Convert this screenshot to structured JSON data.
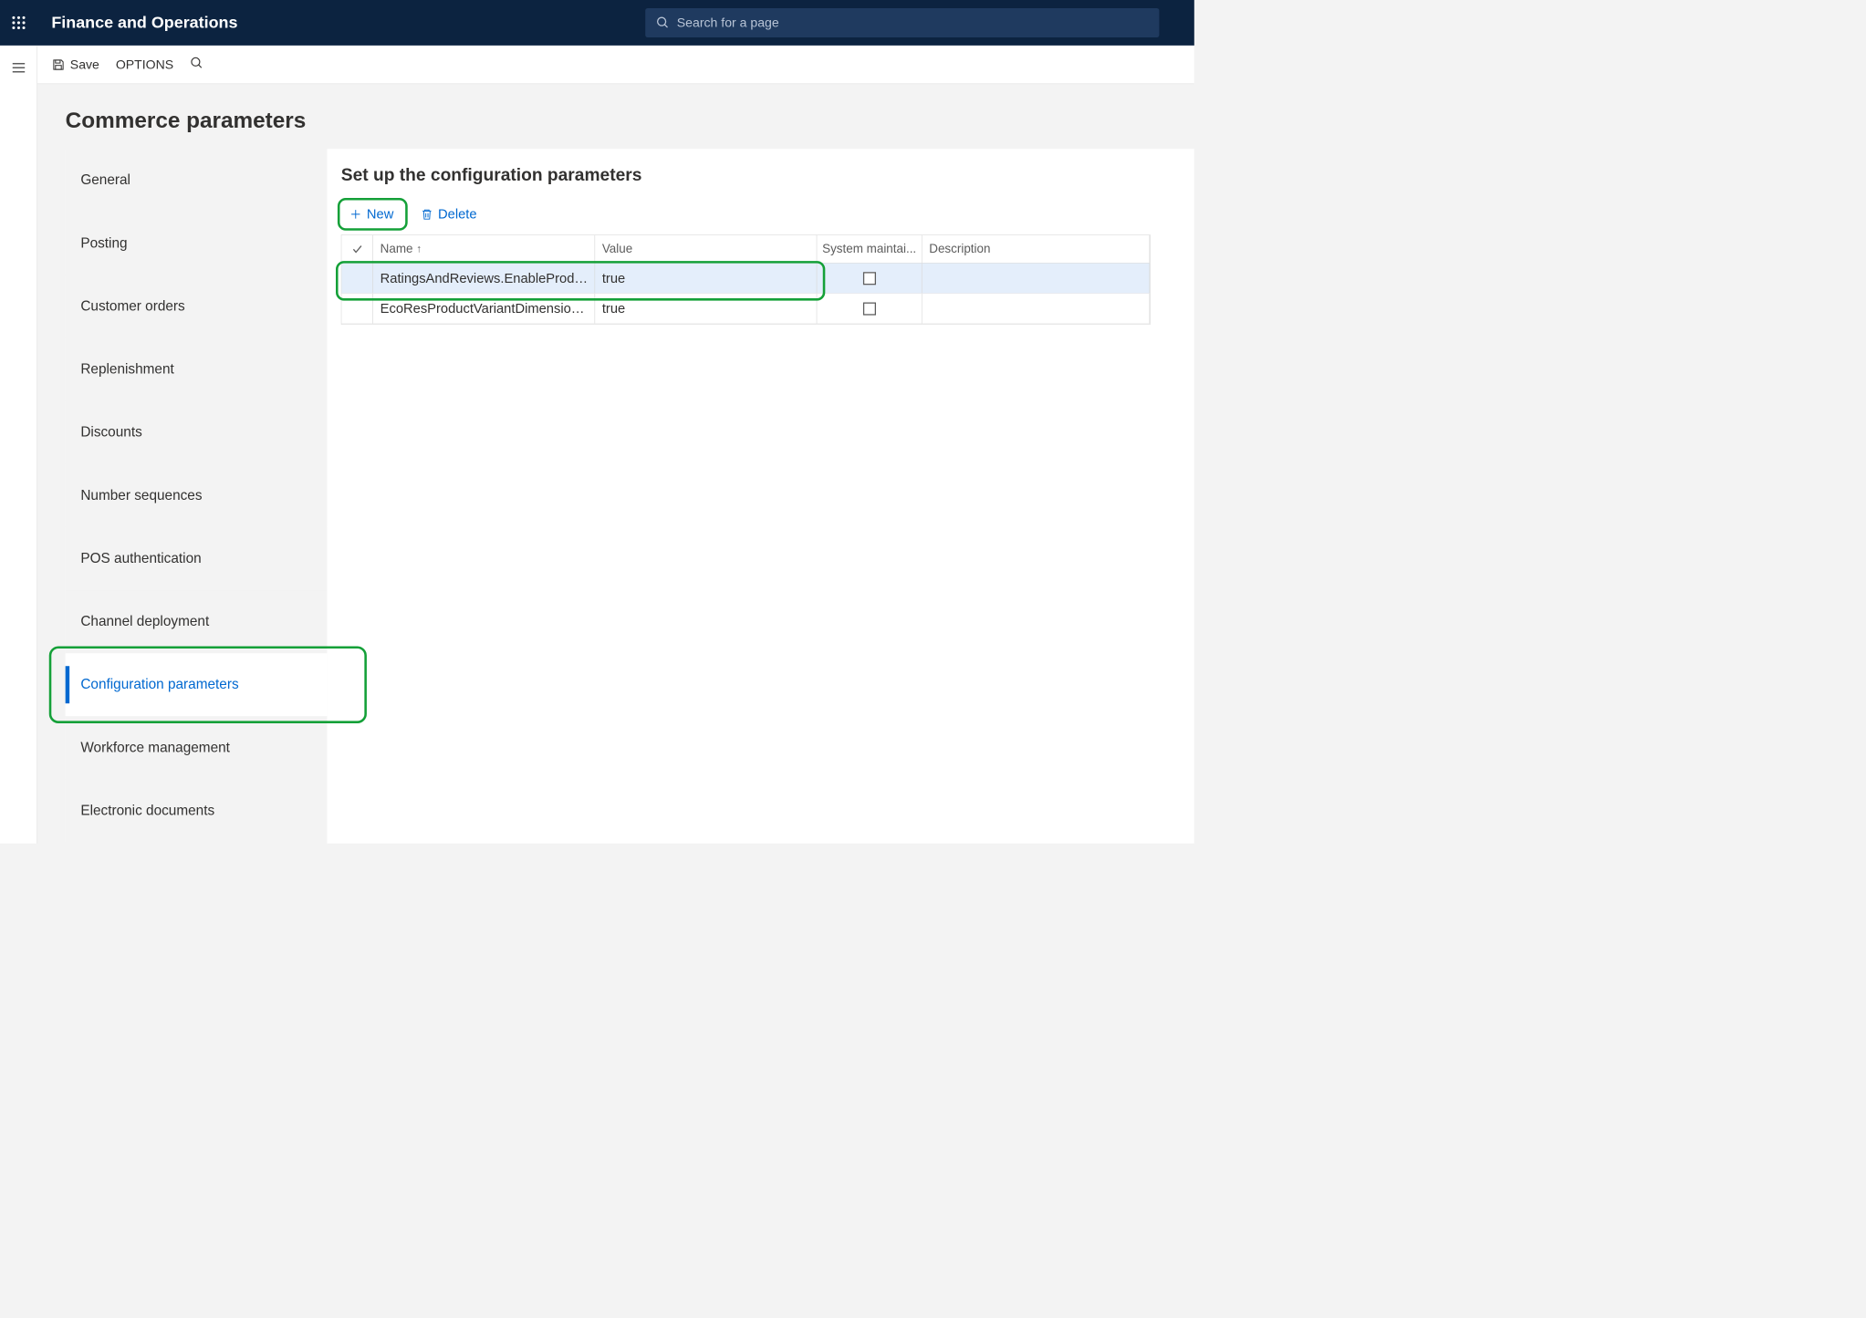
{
  "app": {
    "title": "Finance and Operations"
  },
  "search": {
    "placeholder": "Search for a page"
  },
  "actionbar": {
    "save_label": "Save",
    "options_label": "OPTIONS"
  },
  "page": {
    "title": "Commerce parameters"
  },
  "sidebar": {
    "items": [
      {
        "label": "General"
      },
      {
        "label": "Posting"
      },
      {
        "label": "Customer orders"
      },
      {
        "label": "Replenishment"
      },
      {
        "label": "Discounts"
      },
      {
        "label": "Number sequences"
      },
      {
        "label": "POS authentication"
      },
      {
        "label": "Channel deployment"
      },
      {
        "label": "Configuration parameters"
      },
      {
        "label": "Workforce management"
      },
      {
        "label": "Electronic documents"
      }
    ],
    "active_index": 8
  },
  "main": {
    "title": "Set up the configuration parameters",
    "toolbar": {
      "new_label": "New",
      "delete_label": "Delete"
    },
    "columns": {
      "name": "Name",
      "value": "Value",
      "system": "System maintai...",
      "description": "Description"
    },
    "rows": [
      {
        "name": "RatingsAndReviews.EnableProd…",
        "value": "true",
        "system": false,
        "description": "",
        "selected": true
      },
      {
        "name": "EcoResProductVariantDimensio…",
        "value": "true",
        "system": false,
        "description": "",
        "selected": false
      }
    ]
  }
}
